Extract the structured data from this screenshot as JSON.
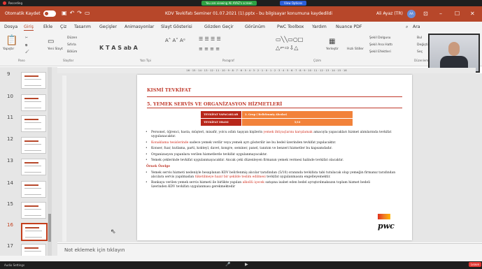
{
  "zoom": {
    "recording": "Recording",
    "share_banner": "You are viewing Ali AYAZ's screen",
    "view_options": "View Options"
  },
  "title": {
    "autosave": "Otomatik Kaydet",
    "document": "KDV Tevkifatı Seminer 01.07.2021 (1).pptx - bu bilgisayar konumuna kaydedildi",
    "user": "Ali Ayaz (TR)",
    "avatar": "AA"
  },
  "menu": [
    "Dosya",
    "Giriş",
    "Ekle",
    "Çiz",
    "Tasarım",
    "Geçişler",
    "Animasyonlar",
    "Slayt Gösterisi",
    "Gözden Geçir",
    "Görünüm",
    "PwC Toolbox",
    "Yardım",
    "Nuance PDF"
  ],
  "menu_right": "Ara",
  "ribbon": {
    "groups": [
      "Pano",
      "Slaytlar",
      "Yazı Tipi",
      "Paragraf",
      "Çizim",
      "Düzenleme"
    ],
    "paste": "Yapıştır",
    "new_slide": "Yeni Slayt",
    "layout": "Düzen",
    "reset": "Sıfırla",
    "section": "Bölüm",
    "arrange": "Yerleştir",
    "quick_styles": "Hızlı Stiller",
    "shape_fill": "Şekil Dolgusu",
    "shape_outline": "Şekil Ana Hattı",
    "shape_effects": "Şekil Efektleri",
    "find": "Bul",
    "replace": "Değiştir",
    "select": "Seç"
  },
  "ruler": "16 · 15 · 14 · 13 · 12 · 11 · 10 · 9 · 8 · 7 · 6 · 5 · 4 · 3 · 2 · 1 · 0 · 1 · 2 · 3 · 4 · 5 · 6 · 7 · 8 · 9 · 10 · 11 · 12 · 13 · 14 · 15 · 16",
  "thumbnails": [
    {
      "num": "9"
    },
    {
      "num": "10"
    },
    {
      "num": "11"
    },
    {
      "num": "12"
    },
    {
      "num": "13"
    },
    {
      "num": "14"
    },
    {
      "num": "15"
    },
    {
      "num": "16"
    },
    {
      "num": "17"
    }
  ],
  "slide": {
    "title": "KISMİ TEVKİFAT",
    "subtitle": "5. YEMEK SERVİS VE ORGANİZASYON HİZMETLERİ",
    "table": [
      {
        "label": "TEVKİFAT YAPACAKLAR",
        "value": "2. Grup ( Belirlenmiş Alıcılar)"
      },
      {
        "label": "TEVKİFAT ORANI",
        "value": "5/10"
      }
    ],
    "b1_pre": "Personel, öğrenci, hasta, müşteri, misafir, yolcu ısfatı taşıyan kişilerin ",
    "b1_red": "yemek ihtiyaçlarını karşılamak",
    "b1_post": " amacıyla yapacakları hizmet alımlarında tevkifat uygulanacaktır.",
    "b2_red": "Konaklama tesislerinde",
    "b2_post": " sadece yemek verilir veya yemek ayrı gösterilir ise bu bedel üzerinden tevkifat yapılacaktır.",
    "b3": "Konser, fuar, kutlama, parti, kokteyl, davet, kongre, seminer, panel, tanıtım ve benzeri hizmetler bu kapsamdadır.",
    "b4": "Organizasyon yapanlara verilen hizmetlerde tevkifat uygulanmayacaktır.",
    "b5": "Yemek çeklerinde tevkifat uygulanmayacaktır. Ancak çeki düzenleyen firmanın yemek vermesi halinde tevkifat olacaktır.",
    "example_head": "Örnek Özelge",
    "b6_pre": "Yemek servis hizmeti nedeniyle hesaplanan KDV belirlenmiş alıcılar tarafından (5/10) oranında tevkifata tabi tutulacak olup yemeğin firmanız tarafından alıcılara servis yapılmadan ",
    "b6_red": "tüketilmeye hazır bir şekilde teslim edilmesi",
    "b6_post": " tevkifat uygulanmasını engelleyemektir.",
    "b7_pre": "Bankaya verilen yemek servis hizmeti ile birlikte yapılan ",
    "b7_red": "alkollü içecek",
    "b7_post": " satışına isabet eden bedel ayrıştırılmaksızın toplam hizmet bedeli üzerinden KDV tevkifatı uygulanması gerekmektedir",
    "logo": "pwc"
  },
  "notes": "Not eklemek için tıklayın",
  "taskbar": {
    "audio": "Audio Settings",
    "leave": "Leave"
  },
  "colors": {
    "accent": "#b7472a",
    "slide_red": "#c0392b",
    "table_dark": "#b8271a",
    "table_light": "#f2823a"
  }
}
